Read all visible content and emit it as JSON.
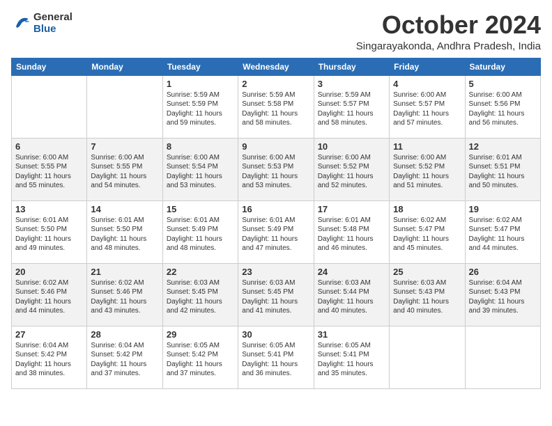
{
  "header": {
    "logo_general": "General",
    "logo_blue": "Blue",
    "month_title": "October 2024",
    "location": "Singarayakonda, Andhra Pradesh, India"
  },
  "days_of_week": [
    "Sunday",
    "Monday",
    "Tuesday",
    "Wednesday",
    "Thursday",
    "Friday",
    "Saturday"
  ],
  "weeks": [
    [
      {
        "day": "",
        "info": ""
      },
      {
        "day": "",
        "info": ""
      },
      {
        "day": "1",
        "info": "Sunrise: 5:59 AM\nSunset: 5:59 PM\nDaylight: 11 hours and 59 minutes."
      },
      {
        "day": "2",
        "info": "Sunrise: 5:59 AM\nSunset: 5:58 PM\nDaylight: 11 hours and 58 minutes."
      },
      {
        "day": "3",
        "info": "Sunrise: 5:59 AM\nSunset: 5:57 PM\nDaylight: 11 hours and 58 minutes."
      },
      {
        "day": "4",
        "info": "Sunrise: 6:00 AM\nSunset: 5:57 PM\nDaylight: 11 hours and 57 minutes."
      },
      {
        "day": "5",
        "info": "Sunrise: 6:00 AM\nSunset: 5:56 PM\nDaylight: 11 hours and 56 minutes."
      }
    ],
    [
      {
        "day": "6",
        "info": "Sunrise: 6:00 AM\nSunset: 5:55 PM\nDaylight: 11 hours and 55 minutes."
      },
      {
        "day": "7",
        "info": "Sunrise: 6:00 AM\nSunset: 5:55 PM\nDaylight: 11 hours and 54 minutes."
      },
      {
        "day": "8",
        "info": "Sunrise: 6:00 AM\nSunset: 5:54 PM\nDaylight: 11 hours and 53 minutes."
      },
      {
        "day": "9",
        "info": "Sunrise: 6:00 AM\nSunset: 5:53 PM\nDaylight: 11 hours and 53 minutes."
      },
      {
        "day": "10",
        "info": "Sunrise: 6:00 AM\nSunset: 5:52 PM\nDaylight: 11 hours and 52 minutes."
      },
      {
        "day": "11",
        "info": "Sunrise: 6:00 AM\nSunset: 5:52 PM\nDaylight: 11 hours and 51 minutes."
      },
      {
        "day": "12",
        "info": "Sunrise: 6:01 AM\nSunset: 5:51 PM\nDaylight: 11 hours and 50 minutes."
      }
    ],
    [
      {
        "day": "13",
        "info": "Sunrise: 6:01 AM\nSunset: 5:50 PM\nDaylight: 11 hours and 49 minutes."
      },
      {
        "day": "14",
        "info": "Sunrise: 6:01 AM\nSunset: 5:50 PM\nDaylight: 11 hours and 48 minutes."
      },
      {
        "day": "15",
        "info": "Sunrise: 6:01 AM\nSunset: 5:49 PM\nDaylight: 11 hours and 48 minutes."
      },
      {
        "day": "16",
        "info": "Sunrise: 6:01 AM\nSunset: 5:49 PM\nDaylight: 11 hours and 47 minutes."
      },
      {
        "day": "17",
        "info": "Sunrise: 6:01 AM\nSunset: 5:48 PM\nDaylight: 11 hours and 46 minutes."
      },
      {
        "day": "18",
        "info": "Sunrise: 6:02 AM\nSunset: 5:47 PM\nDaylight: 11 hours and 45 minutes."
      },
      {
        "day": "19",
        "info": "Sunrise: 6:02 AM\nSunset: 5:47 PM\nDaylight: 11 hours and 44 minutes."
      }
    ],
    [
      {
        "day": "20",
        "info": "Sunrise: 6:02 AM\nSunset: 5:46 PM\nDaylight: 11 hours and 44 minutes."
      },
      {
        "day": "21",
        "info": "Sunrise: 6:02 AM\nSunset: 5:46 PM\nDaylight: 11 hours and 43 minutes."
      },
      {
        "day": "22",
        "info": "Sunrise: 6:03 AM\nSunset: 5:45 PM\nDaylight: 11 hours and 42 minutes."
      },
      {
        "day": "23",
        "info": "Sunrise: 6:03 AM\nSunset: 5:45 PM\nDaylight: 11 hours and 41 minutes."
      },
      {
        "day": "24",
        "info": "Sunrise: 6:03 AM\nSunset: 5:44 PM\nDaylight: 11 hours and 40 minutes."
      },
      {
        "day": "25",
        "info": "Sunrise: 6:03 AM\nSunset: 5:43 PM\nDaylight: 11 hours and 40 minutes."
      },
      {
        "day": "26",
        "info": "Sunrise: 6:04 AM\nSunset: 5:43 PM\nDaylight: 11 hours and 39 minutes."
      }
    ],
    [
      {
        "day": "27",
        "info": "Sunrise: 6:04 AM\nSunset: 5:42 PM\nDaylight: 11 hours and 38 minutes."
      },
      {
        "day": "28",
        "info": "Sunrise: 6:04 AM\nSunset: 5:42 PM\nDaylight: 11 hours and 37 minutes."
      },
      {
        "day": "29",
        "info": "Sunrise: 6:05 AM\nSunset: 5:42 PM\nDaylight: 11 hours and 37 minutes."
      },
      {
        "day": "30",
        "info": "Sunrise: 6:05 AM\nSunset: 5:41 PM\nDaylight: 11 hours and 36 minutes."
      },
      {
        "day": "31",
        "info": "Sunrise: 6:05 AM\nSunset: 5:41 PM\nDaylight: 11 hours and 35 minutes."
      },
      {
        "day": "",
        "info": ""
      },
      {
        "day": "",
        "info": ""
      }
    ]
  ]
}
